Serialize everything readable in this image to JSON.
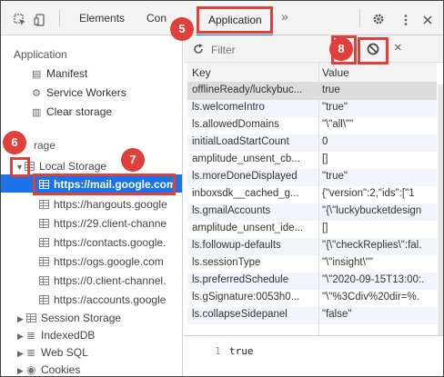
{
  "toolbar": {
    "tabs": [
      {
        "label": "Elements"
      },
      {
        "label": "Con"
      },
      {
        "label": "Application"
      }
    ],
    "more": "»"
  },
  "sidebar": {
    "application_title": "Application",
    "app_items": [
      {
        "label": "Manifest",
        "icon": "document-icon"
      },
      {
        "label": "Service Workers",
        "icon": "gear-icon"
      },
      {
        "label": "Clear storage",
        "icon": "trash-icon"
      }
    ],
    "storage_title": "rage",
    "local_storage": "Local Storage",
    "origins": [
      "https://mail.google.com",
      "https://hangouts.google",
      "https://29.client-channe",
      "https://contacts.google.",
      "https://ogs.google.com",
      "https://0.client-channel.",
      "https://accounts.google"
    ],
    "other_storage": [
      {
        "label": "Session Storage"
      },
      {
        "label": "IndexedDB"
      },
      {
        "label": "Web SQL"
      },
      {
        "label": "Cookies"
      }
    ]
  },
  "filter": {
    "placeholder": "Filter",
    "clear": "×"
  },
  "table": {
    "headers": {
      "key": "Key",
      "value": "Value"
    },
    "rows": [
      {
        "key": "offlineReady/luckybuc...",
        "value": "true"
      },
      {
        "key": "ls.welcomeIntro",
        "value": "\"true\""
      },
      {
        "key": "ls.allowedDomains",
        "value": "\"\\\"all\\\"\""
      },
      {
        "key": "initialLoadStartCount",
        "value": "0"
      },
      {
        "key": "amplitude_unsent_cb...",
        "value": "[]"
      },
      {
        "key": "ls.moreDoneDisplayed",
        "value": "\"true\""
      },
      {
        "key": "inboxsdk__cached_g...",
        "value": "{\"version\":2,\"ids\":[\"1"
      },
      {
        "key": "ls.gmailAccounts",
        "value": "\"{\\\"luckybucketdesign"
      },
      {
        "key": "amplitude_unsent_ide...",
        "value": "[]"
      },
      {
        "key": "ls.followup-defaults",
        "value": "\"{\\\"checkReplies\\\":fal."
      },
      {
        "key": "ls.sessionType",
        "value": "\"\\\"insight\\\"\""
      },
      {
        "key": "ls.preferredSchedule",
        "value": "\"\\\"2020-09-15T13:00:."
      },
      {
        "key": "ls.gSignature:0053h0...",
        "value": "\"\\\"%3Cdiv%20dir=%."
      },
      {
        "key": "ls.collapseSidepanel",
        "value": "\"false\""
      }
    ]
  },
  "preview": {
    "line": "1",
    "text": "true"
  },
  "badges": {
    "b5": "5",
    "b6": "6",
    "b7": "7",
    "b8": "8"
  },
  "colors": {
    "accent": "#1a73e8",
    "callout": "#e0403a"
  }
}
